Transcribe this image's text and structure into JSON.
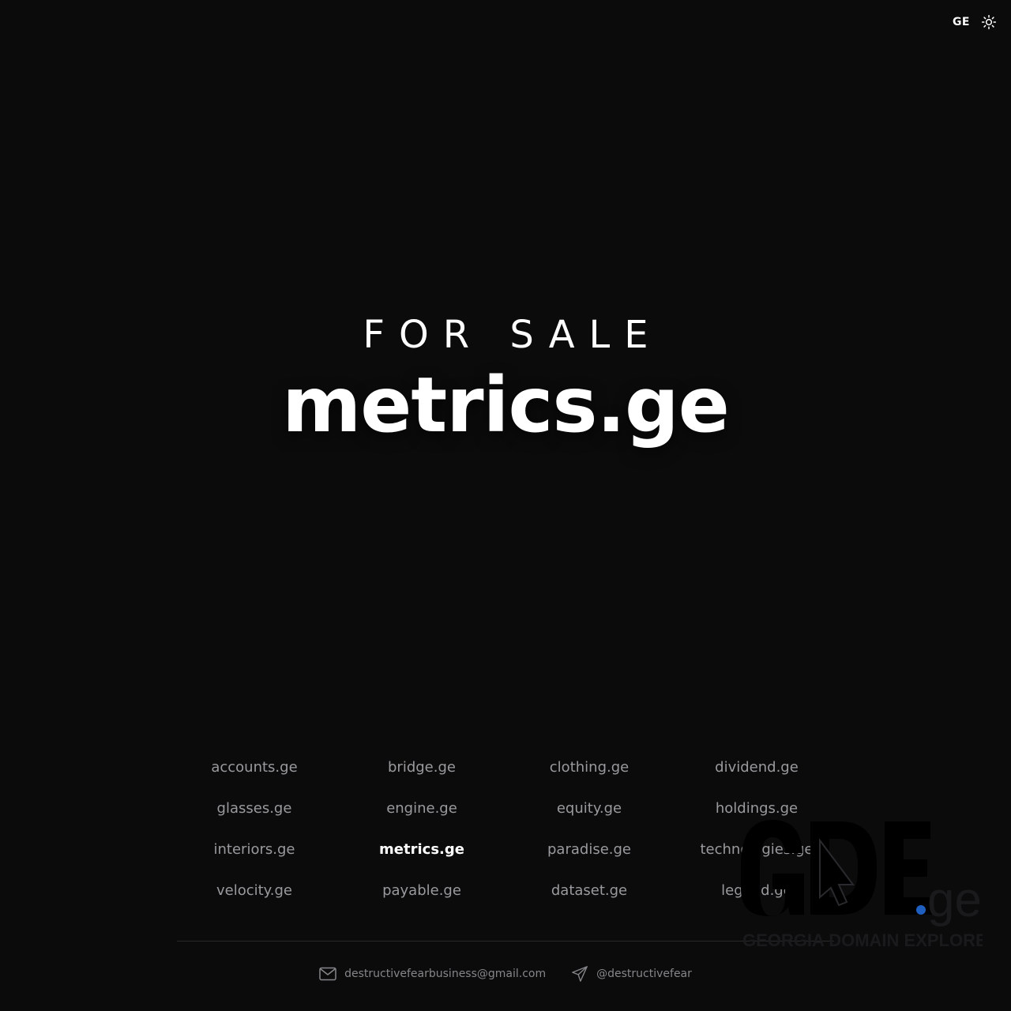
{
  "header": {
    "lang": "GE",
    "theme_icon": "sun-icon"
  },
  "hero": {
    "tagline": "FOR SALE",
    "domain": "metrics.ge"
  },
  "domains": [
    {
      "label": "accounts.ge",
      "active": false
    },
    {
      "label": "bridge.ge",
      "active": false
    },
    {
      "label": "clothing.ge",
      "active": false
    },
    {
      "label": "dividend.ge",
      "active": false
    },
    {
      "label": "glasses.ge",
      "active": false
    },
    {
      "label": "engine.ge",
      "active": false
    },
    {
      "label": "equity.ge",
      "active": false
    },
    {
      "label": "holdings.ge",
      "active": false
    },
    {
      "label": "interiors.ge",
      "active": false
    },
    {
      "label": "metrics.ge",
      "active": true
    },
    {
      "label": "paradise.ge",
      "active": false
    },
    {
      "label": "technologies.ge",
      "active": false
    },
    {
      "label": "velocity.ge",
      "active": false
    },
    {
      "label": "payable.ge",
      "active": false
    },
    {
      "label": "dataset.ge",
      "active": false
    },
    {
      "label": "legend.ge",
      "active": false
    }
  ],
  "contacts": {
    "email": "destructivefearbusiness@gmail.com",
    "email_icon": "mail-icon",
    "telegram": "@destructivefear",
    "telegram_icon": "send-icon"
  },
  "watermark": {
    "logo": "GDE",
    "suffix": ".ge",
    "caption": "GEORGIA DOMAIN EXPLORER",
    "dot_color": "#1f5fbf"
  }
}
